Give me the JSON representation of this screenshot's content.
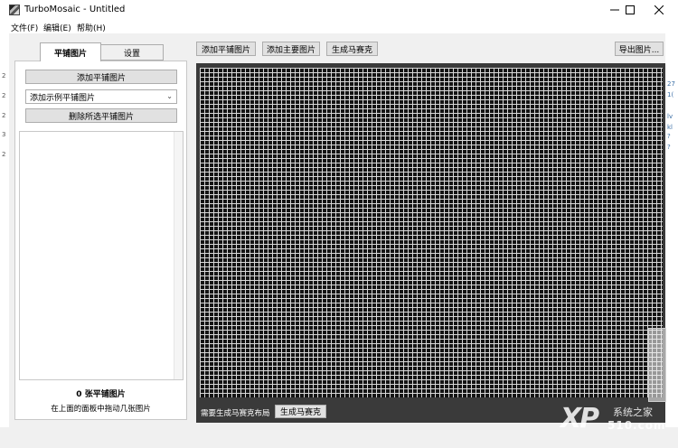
{
  "window": {
    "title": "TurboMosaic - Untitled",
    "minimize_icon": "minimize-icon",
    "maximize_icon": "maximize-icon",
    "close_icon": "close-icon"
  },
  "menu": {
    "file": "文件(F)",
    "edit": "编辑(E)",
    "help": "帮助(H)"
  },
  "tabs": {
    "tiles": "平铺图片",
    "settings": "设置"
  },
  "left_panel": {
    "add_tiles_button": "添加平铺图片",
    "sample_select_value": "添加示例平铺图片",
    "delete_selected_button": "删除所选平铺图片",
    "tile_count": "0 张平铺图片",
    "hint": "在上面的面板中拖动几张图片"
  },
  "toolbar": {
    "add_tiles": "添加平铺图片",
    "add_main_image": "添加主要图片",
    "generate_mosaic": "生成马赛克",
    "export_image": "导出图片..."
  },
  "mosaic": {
    "layout_status": "需要生成马赛克布局",
    "generate_button": "生成马赛克"
  },
  "edge_marks": {
    "left": [
      "2",
      "2",
      "2",
      "3",
      "2"
    ],
    "right": [
      "27",
      "1(",
      "lv",
      "kl",
      "?",
      "?"
    ]
  },
  "watermark": {
    "big": "XP",
    "top": "系统之家",
    "bottom": "510.com"
  },
  "colors": {
    "client_bg": "#f0f0f0",
    "mosaic_bg": "#141414",
    "grid_line": "#d8d8d8",
    "button_bg": "#e1e1e1"
  }
}
